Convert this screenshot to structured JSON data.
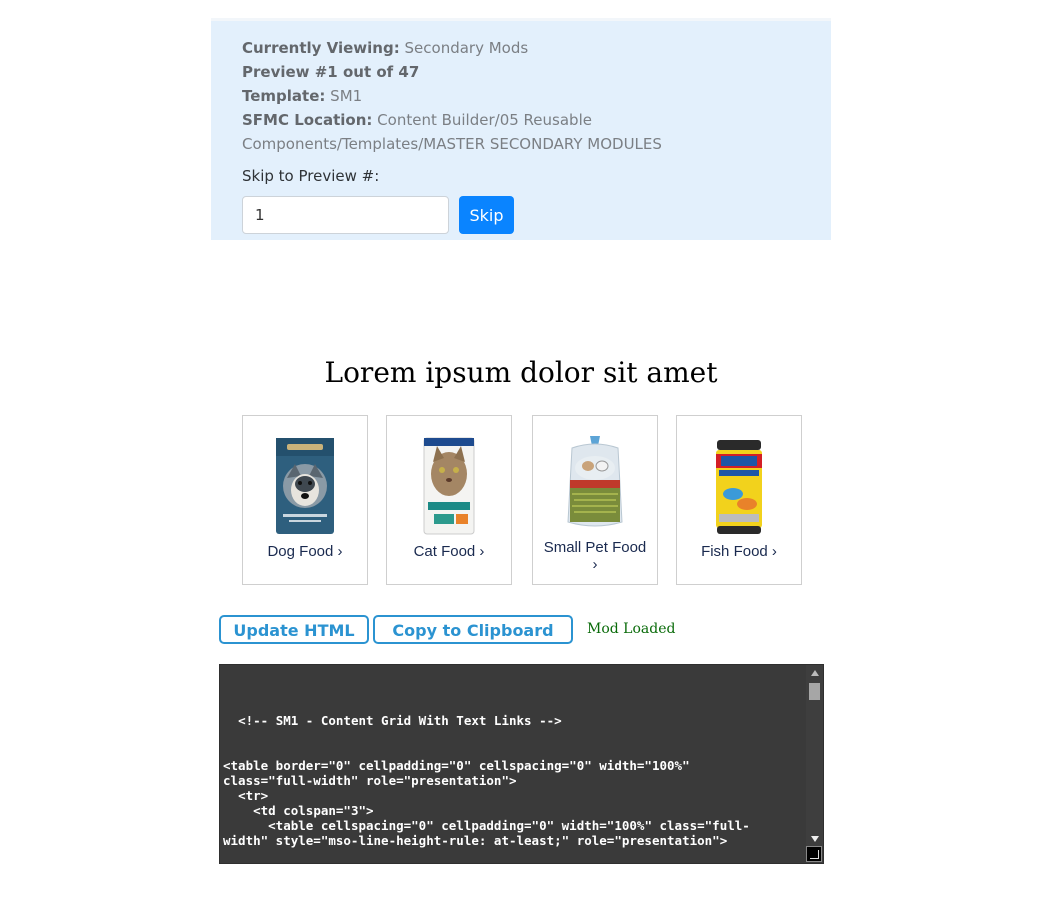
{
  "info": {
    "viewing_label": "Currently Viewing:",
    "viewing_value": "Secondary Mods",
    "preview_text": "Preview #1 out of 47",
    "template_label": "Template:",
    "template_value": "SM1",
    "location_label": "SFMC Location:",
    "location_value": "Content Builder/05 Reusable Components/Templates/MASTER SECONDARY MODULES",
    "skip_label": "Skip to Preview #:",
    "skip_value": "1",
    "skip_button": "Skip"
  },
  "module": {
    "headline": "Lorem ipsum dolor sit amet",
    "cards": [
      {
        "label": "Dog Food ›"
      },
      {
        "label": "Cat Food ›"
      },
      {
        "label_line1": "Small Pet Food",
        "label_line2": "›"
      },
      {
        "label": "Fish Food ›"
      }
    ]
  },
  "actions": {
    "update_button": "Update HTML",
    "copy_button": "Copy to Clipboard",
    "status": "Mod Loaded"
  },
  "code": {
    "text": "  <!-- SM1 - Content Grid With Text Links -->\n\n\n<table border=\"0\" cellpadding=\"0\" cellspacing=\"0\" width=\"100%\" class=\"full-width\" role=\"presentation\">\n  <tr>\n    <td colspan=\"3\">\n      <table cellspacing=\"0\" cellpadding=\"0\" width=\"100%\" class=\"full-width\" style=\"mso-line-height-rule: at-least;\" role=\"presentation\">"
  },
  "colors": {
    "panel_bg": "#e3f0fc",
    "accent_blue": "#0a84ff",
    "outline_blue": "#2b93d1",
    "status_green": "#0a6b0a",
    "code_bg": "#3a3a3a"
  }
}
